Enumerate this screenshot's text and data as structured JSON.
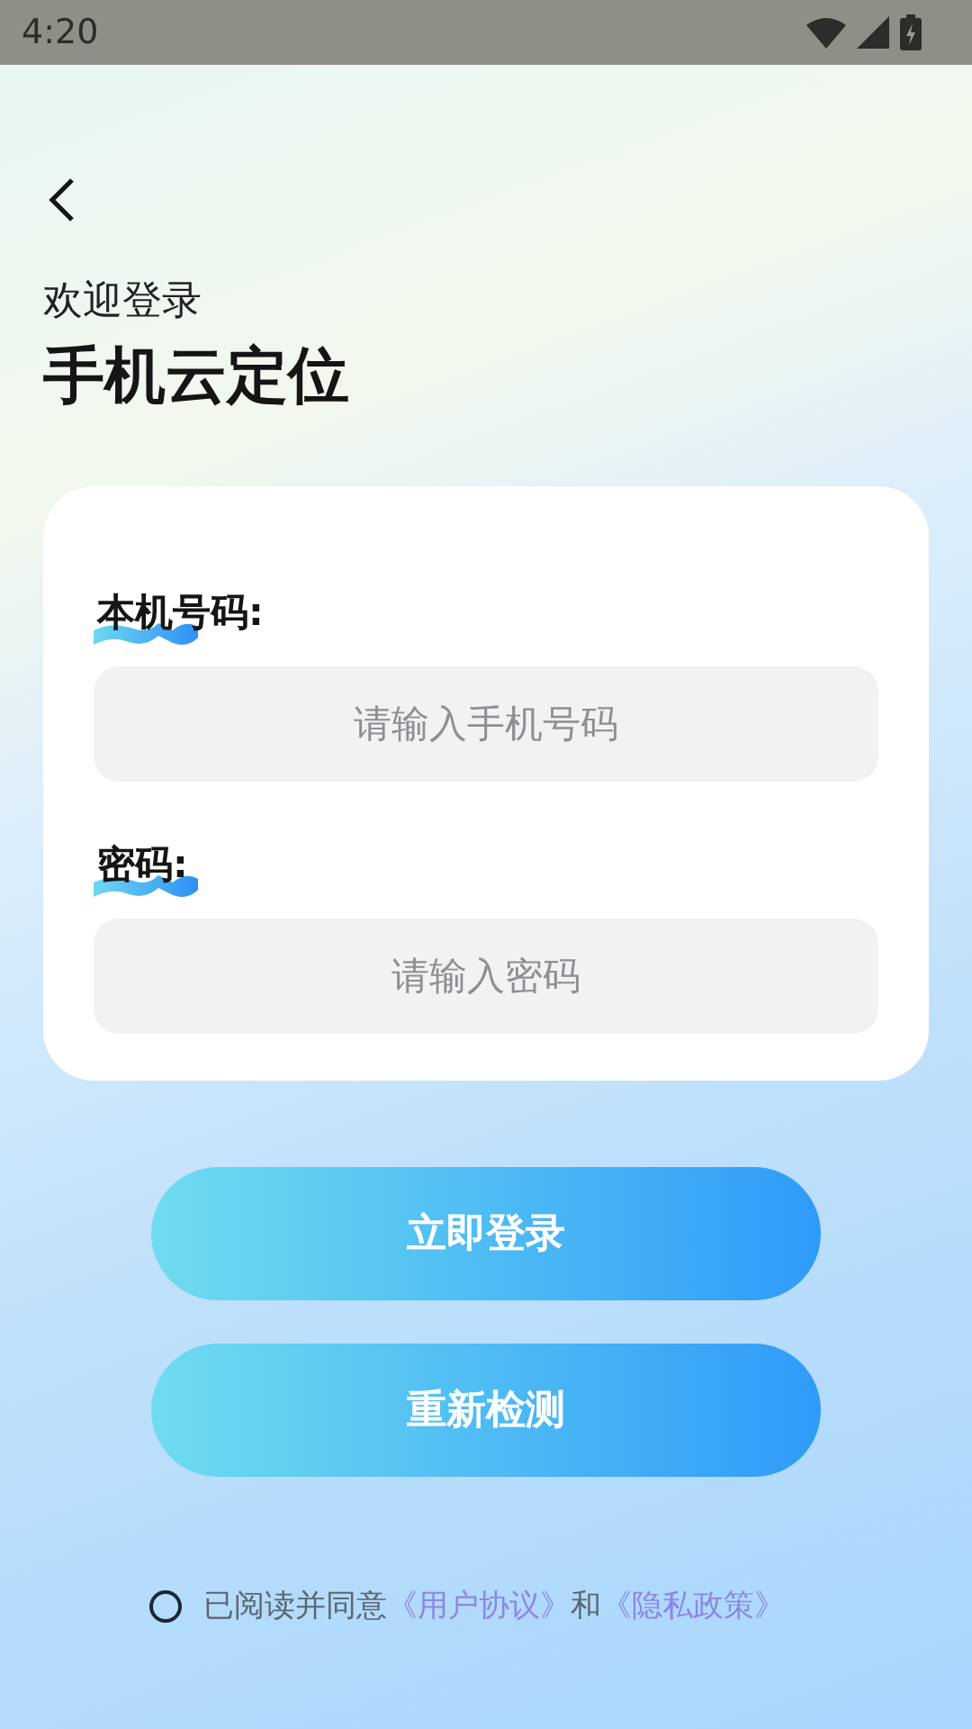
{
  "status_bar": {
    "time": "4:20"
  },
  "header": {
    "greeting": "欢迎登录",
    "title": "手机云定位"
  },
  "form": {
    "fields": [
      {
        "label": "本机号码:",
        "placeholder": "请输入手机号码"
      },
      {
        "label": "密码:",
        "placeholder": "请输入密码"
      }
    ]
  },
  "buttons": [
    "立即登录",
    "重新检测"
  ],
  "agreement": {
    "checked": false,
    "text": "已阅读并同意",
    "link_1": "《用户协议》",
    "joiner": "和",
    "link_2": "《隐私政策》"
  }
}
